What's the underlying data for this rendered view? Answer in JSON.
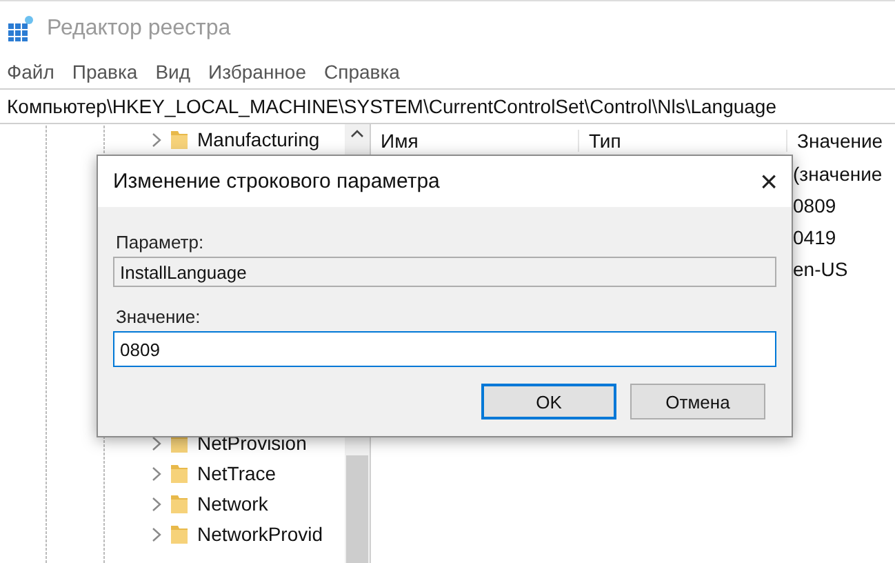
{
  "window": {
    "title": "Редактор реестра"
  },
  "menu": [
    {
      "label": "Файл"
    },
    {
      "label": "Правка"
    },
    {
      "label": "Вид"
    },
    {
      "label": "Избранное"
    },
    {
      "label": "Справка"
    }
  ],
  "address_bar": {
    "path": "Компьютер\\HKEY_LOCAL_MACHINE\\SYSTEM\\CurrentControlSet\\Control\\Nls\\Language"
  },
  "tree": {
    "top_items": [
      {
        "label": "Manufacturing",
        "expanded": false
      }
    ],
    "bottom_items": [
      {
        "label": "NetProvision",
        "expanded": false
      },
      {
        "label": "NetTrace",
        "expanded": false
      },
      {
        "label": "Network",
        "expanded": false
      },
      {
        "label": "NetworkProvid",
        "expanded": false
      }
    ]
  },
  "list": {
    "columns": [
      "Имя",
      "Тип",
      "Значение"
    ],
    "value_cells": [
      "(значение",
      "0809",
      "0419",
      "en-US"
    ]
  },
  "dialog": {
    "title": "Изменение строкового параметра",
    "close": "×",
    "name_label": "Параметр:",
    "name_value": "InstallLanguage",
    "value_label": "Значение:",
    "value": "0809",
    "buttons": [
      {
        "label": "OK",
        "default": true
      },
      {
        "label": "Отмена",
        "default": false
      }
    ]
  }
}
